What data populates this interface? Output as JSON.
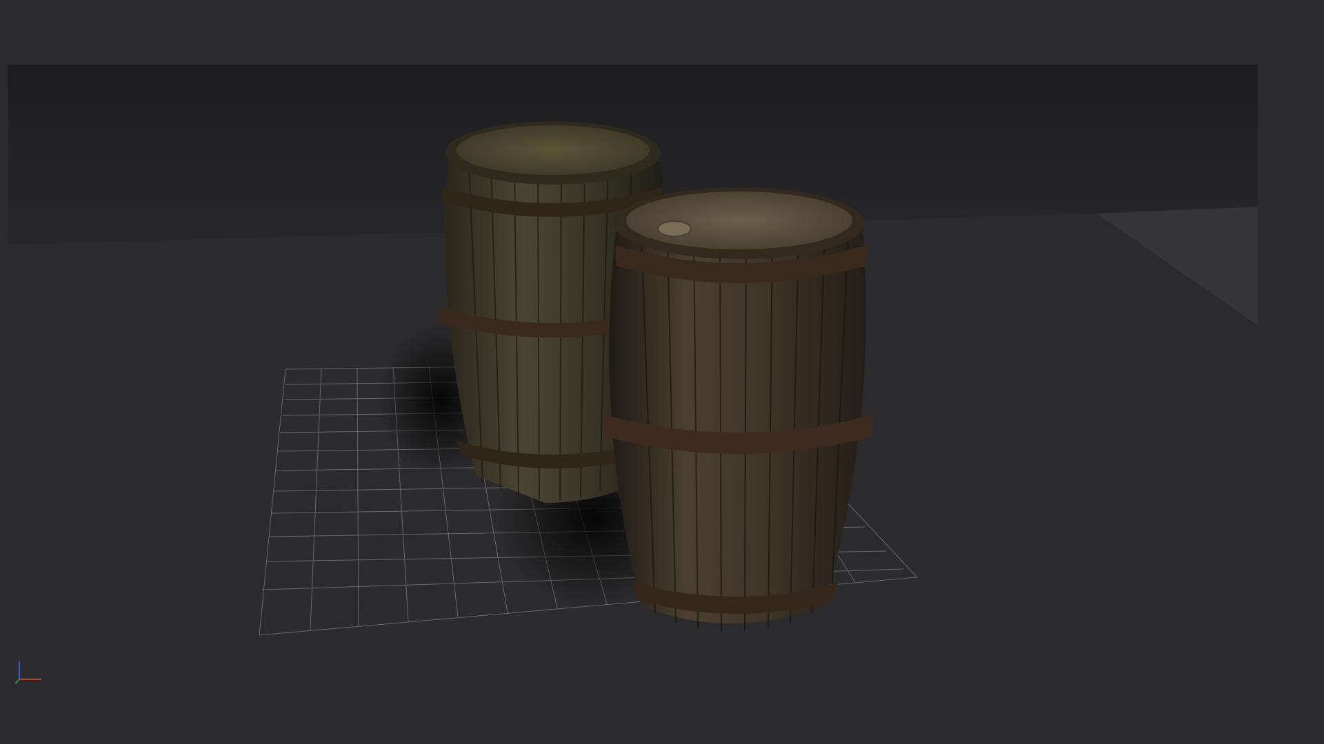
{
  "viewport": {
    "background_color": "#2b2b2d",
    "backdrop_color": "#1f1f21",
    "grid_color": "#9a9a9a"
  },
  "scene": {
    "objects": [
      {
        "id": "barrel-back",
        "type": "wooden-barrel",
        "has_bung": false
      },
      {
        "id": "barrel-front",
        "type": "wooden-barrel",
        "has_bung": true
      }
    ],
    "wood_color": "#4a4234",
    "hoop_color": "#3a2c22"
  },
  "axis_gizmo": {
    "icon": "xyz-axis-icon",
    "x_color": "#c0392b",
    "y_color": "#2e8b57",
    "z_color": "#3b5bdb"
  }
}
